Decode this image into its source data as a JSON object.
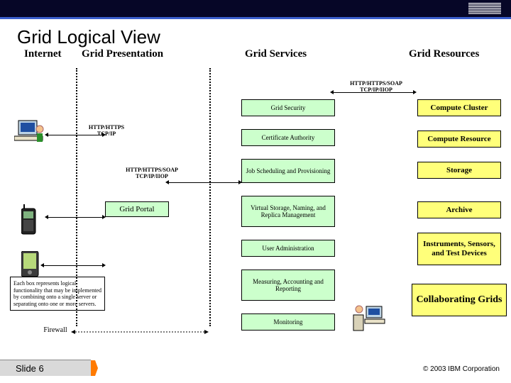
{
  "title": "Grid Logical View",
  "headers": {
    "internet": "Internet",
    "presentation": "Grid Presentation",
    "services": "Grid Services",
    "resources": "Grid Resources"
  },
  "proto": {
    "p1": "HTTP/HTTPS\nTCP/IP",
    "p2": "HTTP/HTTPS/SOAP\nTCP/IP/IIOP",
    "p3": "HTTP/HTTPS/SOAP\nTCP/IP/IIOP"
  },
  "presentation": {
    "portal": "Grid Portal"
  },
  "services": {
    "security": "Grid Security",
    "ca": "Certificate Authority",
    "sched": "Job Scheduling and Provisioning",
    "virtual": "Virtual Storage, Naming, and Replica Management",
    "admin": "User Administration",
    "measure": "Measuring, Accounting and Reporting",
    "monitor": "Monitoring"
  },
  "resources": {
    "cluster": "Compute Cluster",
    "compute": "Compute Resource",
    "storage": "Storage",
    "archive": "Archive",
    "instruments": "Instruments, Sensors, and Test Devices",
    "grids": "Collaborating Grids"
  },
  "note": "Each box represents logical functionality that may be implemented by combining onto a single server or separating onto one or more servers.",
  "fwlabel": "Firewall",
  "footer": {
    "slide": "Slide  6",
    "copy": "© 2003 IBM Corporation"
  }
}
